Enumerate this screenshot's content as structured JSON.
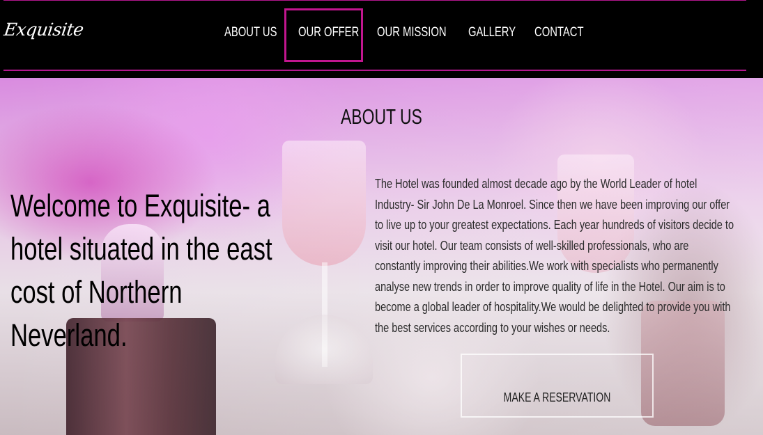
{
  "header": {
    "logo": "Exquisite",
    "nav": [
      {
        "label": "ABOUT US",
        "active": false
      },
      {
        "label": "OUR OFFER",
        "active": true
      },
      {
        "label": "OUR MISSION",
        "active": false
      },
      {
        "label": "GALLERY",
        "active": false
      },
      {
        "label": "CONTACT",
        "active": false
      }
    ]
  },
  "hero": {
    "section_title": "ABOUT US",
    "welcome_text": "Welcome to Exquisite- a hotel situated in the east cost of Northern Neverland.",
    "about_text": "The Hotel was founded almost decade ago by the World Leader of hotel Industry- Sir John De La Monroel. Since then we have been improving our offer to live up to your greatest expectations. Each year hundreds of visitors decide to visit our hotel. Our team consists of well-skilled professionals, who are constantly improving their abilities.We work with specialists who permanently analyse new trends in order to improve quality of life in the Hotel. Our aim is to become a global leader of hospitality.We would be delighted to provide you with the best services according to your wishes or needs.",
    "reservation_button": "MAKE A RESERVATION"
  },
  "colors": {
    "accent": "#c2168f",
    "header_bg": "#000000"
  }
}
